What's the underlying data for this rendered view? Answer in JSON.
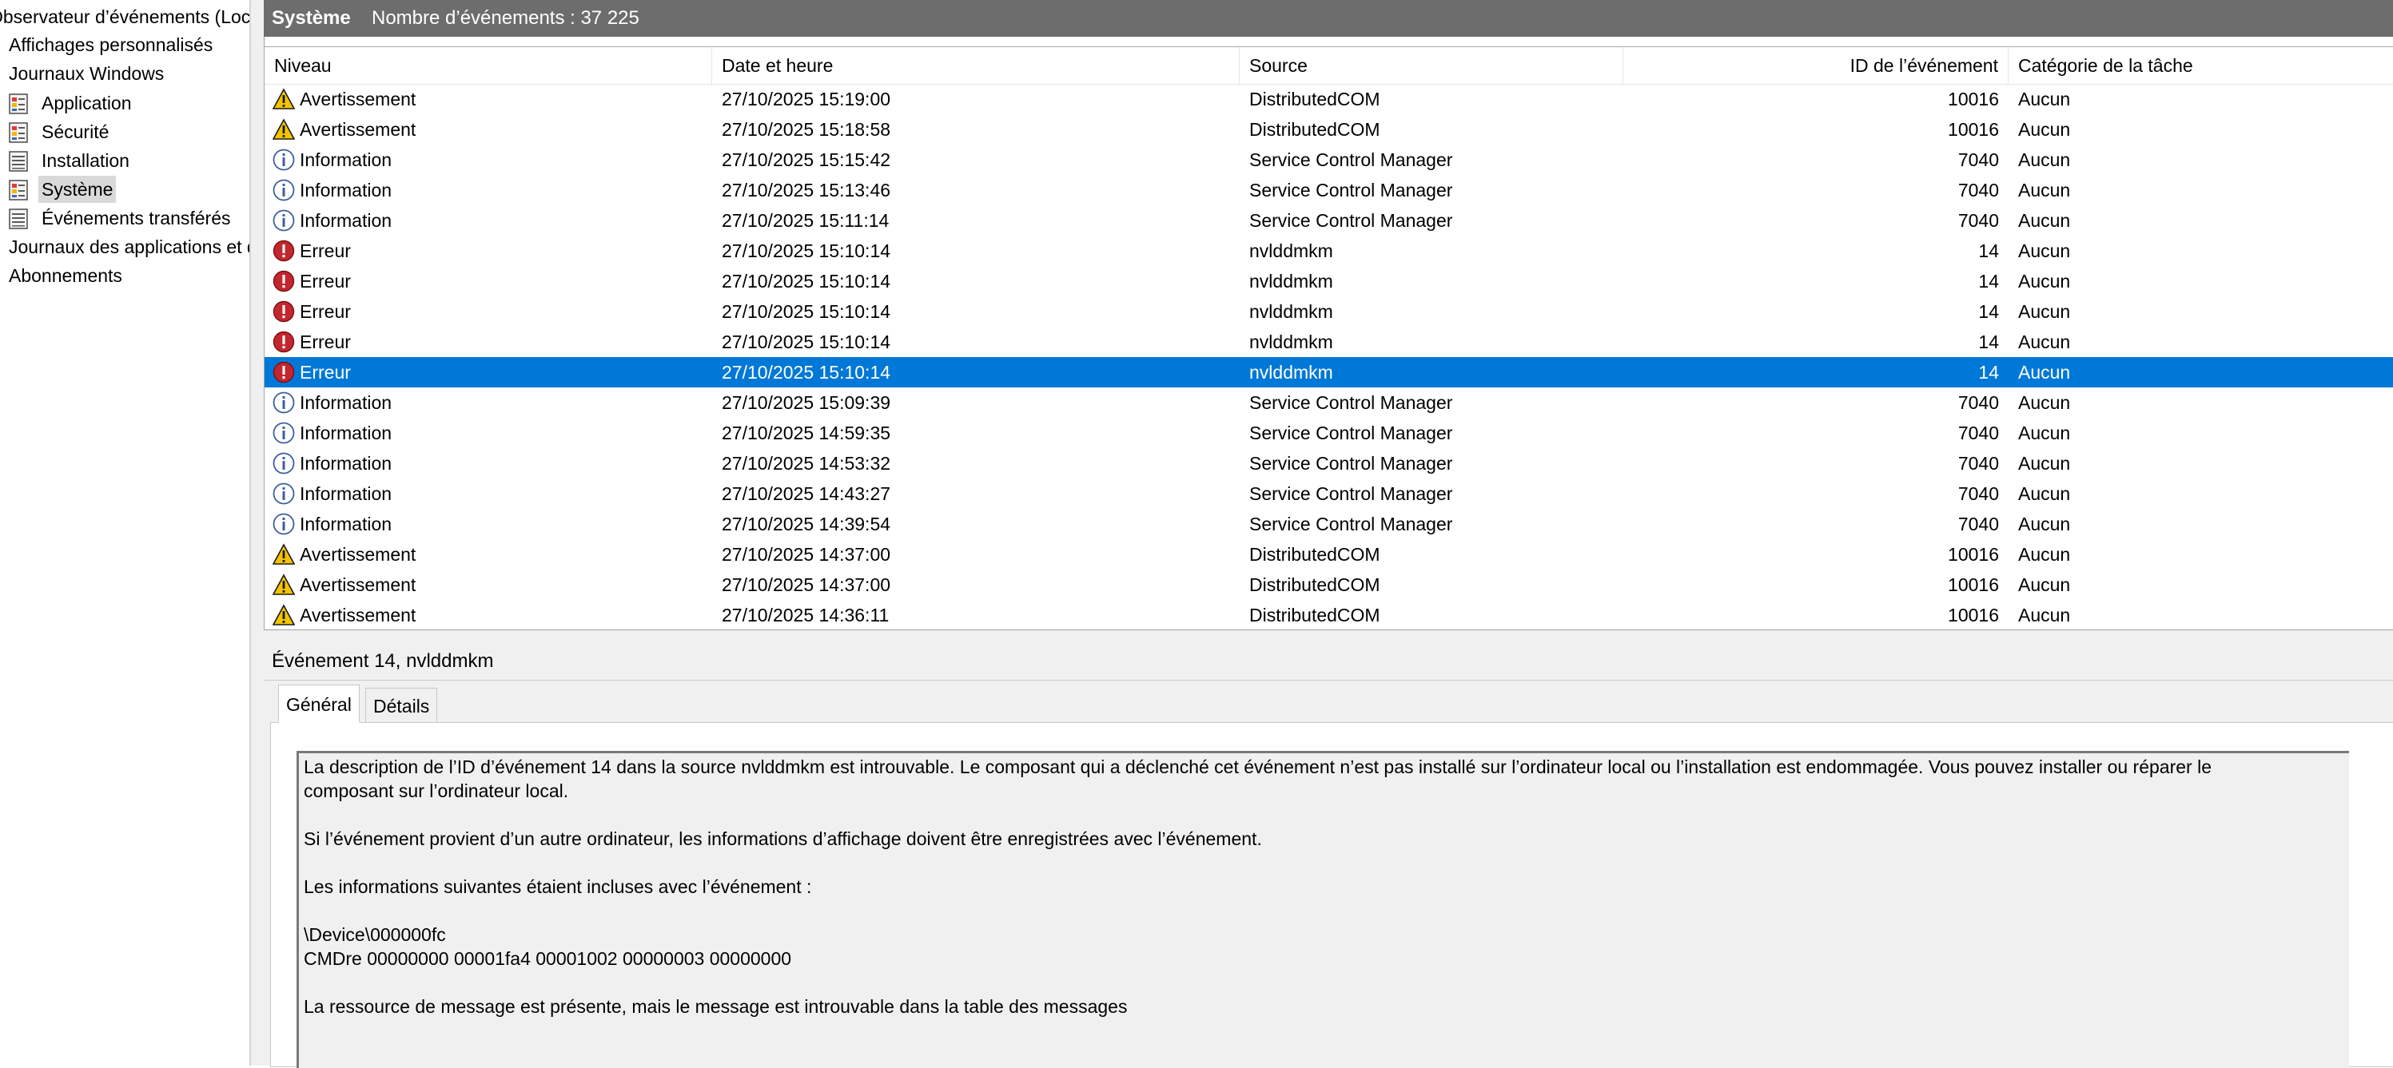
{
  "tree": {
    "root": "Observateur d’événements (Local)",
    "items": [
      {
        "label": "Affichages personnalisés"
      },
      {
        "label": "Journaux Windows"
      },
      {
        "label": "Application"
      },
      {
        "label": "Sécurité"
      },
      {
        "label": "Installation"
      },
      {
        "label": "Système"
      },
      {
        "label": "Événements transférés"
      },
      {
        "label": "Journaux des applications et de services"
      },
      {
        "label": "Abonnements"
      }
    ]
  },
  "header": {
    "title": "Système",
    "count": "Nombre d’événements : 37 225"
  },
  "columns": {
    "level": "Niveau",
    "date": "Date et heure",
    "source": "Source",
    "id": "ID de l’événement",
    "category": "Catégorie de la tâche"
  },
  "events": [
    {
      "level": "Avertissement",
      "icon": "warning-icon",
      "date": "27/10/2025 15:19:00",
      "source": "DistributedCOM",
      "id": "10016",
      "category": "Aucun"
    },
    {
      "level": "Avertissement",
      "icon": "warning-icon",
      "date": "27/10/2025 15:18:58",
      "source": "DistributedCOM",
      "id": "10016",
      "category": "Aucun"
    },
    {
      "level": "Information",
      "icon": "info-icon",
      "date": "27/10/2025 15:15:42",
      "source": "Service Control Manager",
      "id": "7040",
      "category": "Aucun"
    },
    {
      "level": "Information",
      "icon": "info-icon",
      "date": "27/10/2025 15:13:46",
      "source": "Service Control Manager",
      "id": "7040",
      "category": "Aucun"
    },
    {
      "level": "Information",
      "icon": "info-icon",
      "date": "27/10/2025 15:11:14",
      "source": "Service Control Manager",
      "id": "7040",
      "category": "Aucun"
    },
    {
      "level": "Erreur",
      "icon": "error-icon",
      "date": "27/10/2025 15:10:14",
      "source": "nvlddmkm",
      "id": "14",
      "category": "Aucun"
    },
    {
      "level": "Erreur",
      "icon": "error-icon",
      "date": "27/10/2025 15:10:14",
      "source": "nvlddmkm",
      "id": "14",
      "category": "Aucun"
    },
    {
      "level": "Erreur",
      "icon": "error-icon",
      "date": "27/10/2025 15:10:14",
      "source": "nvlddmkm",
      "id": "14",
      "category": "Aucun"
    },
    {
      "level": "Erreur",
      "icon": "error-icon",
      "date": "27/10/2025 15:10:14",
      "source": "nvlddmkm",
      "id": "14",
      "category": "Aucun"
    },
    {
      "level": "Erreur",
      "icon": "error-icon",
      "date": "27/10/2025 15:10:14",
      "source": "nvlddmkm",
      "id": "14",
      "category": "Aucun",
      "selected": true
    },
    {
      "level": "Information",
      "icon": "info-icon",
      "date": "27/10/2025 15:09:39",
      "source": "Service Control Manager",
      "id": "7040",
      "category": "Aucun"
    },
    {
      "level": "Information",
      "icon": "info-icon",
      "date": "27/10/2025 14:59:35",
      "source": "Service Control Manager",
      "id": "7040",
      "category": "Aucun"
    },
    {
      "level": "Information",
      "icon": "info-icon",
      "date": "27/10/2025 14:53:32",
      "source": "Service Control Manager",
      "id": "7040",
      "category": "Aucun"
    },
    {
      "level": "Information",
      "icon": "info-icon",
      "date": "27/10/2025 14:43:27",
      "source": "Service Control Manager",
      "id": "7040",
      "category": "Aucun"
    },
    {
      "level": "Information",
      "icon": "info-icon",
      "date": "27/10/2025 14:39:54",
      "source": "Service Control Manager",
      "id": "7040",
      "category": "Aucun"
    },
    {
      "level": "Avertissement",
      "icon": "warning-icon",
      "date": "27/10/2025 14:37:00",
      "source": "DistributedCOM",
      "id": "10016",
      "category": "Aucun"
    },
    {
      "level": "Avertissement",
      "icon": "warning-icon",
      "date": "27/10/2025 14:37:00",
      "source": "DistributedCOM",
      "id": "10016",
      "category": "Aucun"
    },
    {
      "level": "Avertissement",
      "icon": "warning-icon",
      "date": "27/10/2025 14:36:11",
      "source": "DistributedCOM",
      "id": "10016",
      "category": "Aucun"
    }
  ],
  "detail": {
    "title": "Événement 14, nvlddmkm",
    "tabs": {
      "general": "Général",
      "details": "Détails"
    },
    "lines": [
      "La description de l’ID d’événement 14 dans la source nvlddmkm est introuvable. Le composant qui a déclenché cet événement n’est pas installé sur l’ordinateur local ou l’installation est endommagée. Vous pouvez installer ou réparer le",
      "composant sur l’ordinateur local.",
      "Si l’événement provient d’un autre ordinateur, les informations d’affichage doivent être enregistrées avec l’événement.",
      "Les informations suivantes étaient incluses avec l’événement :",
      "\\Device\\000000fc",
      "CMDre 00000000 00001fa4 00001002 00000003 00000000",
      "La ressource de message est présente, mais le message est introuvable dans la table des messages"
    ]
  },
  "colors": {
    "selection": "#0078d7",
    "header_bg": "#6d6d6d",
    "warning": "#f5c400",
    "error": "#c4262e",
    "info": "#3c67b5"
  }
}
